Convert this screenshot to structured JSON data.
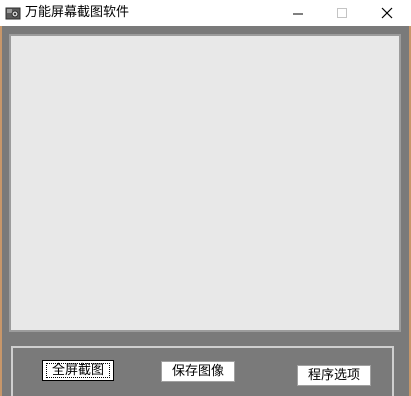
{
  "window": {
    "title": "万能屏幕截图软件"
  },
  "icons": {
    "app": "camera-icon",
    "minimize": "minimize-icon",
    "maximize": "maximize-icon",
    "close": "close-icon"
  },
  "buttons": {
    "fullscreen_capture": "全屏截图",
    "save_image": "保存图像",
    "program_options": "程序选项"
  },
  "colors": {
    "client_background": "#7a7a7a",
    "canvas_background": "#e8e8e8",
    "window_border": "#c8976a"
  }
}
